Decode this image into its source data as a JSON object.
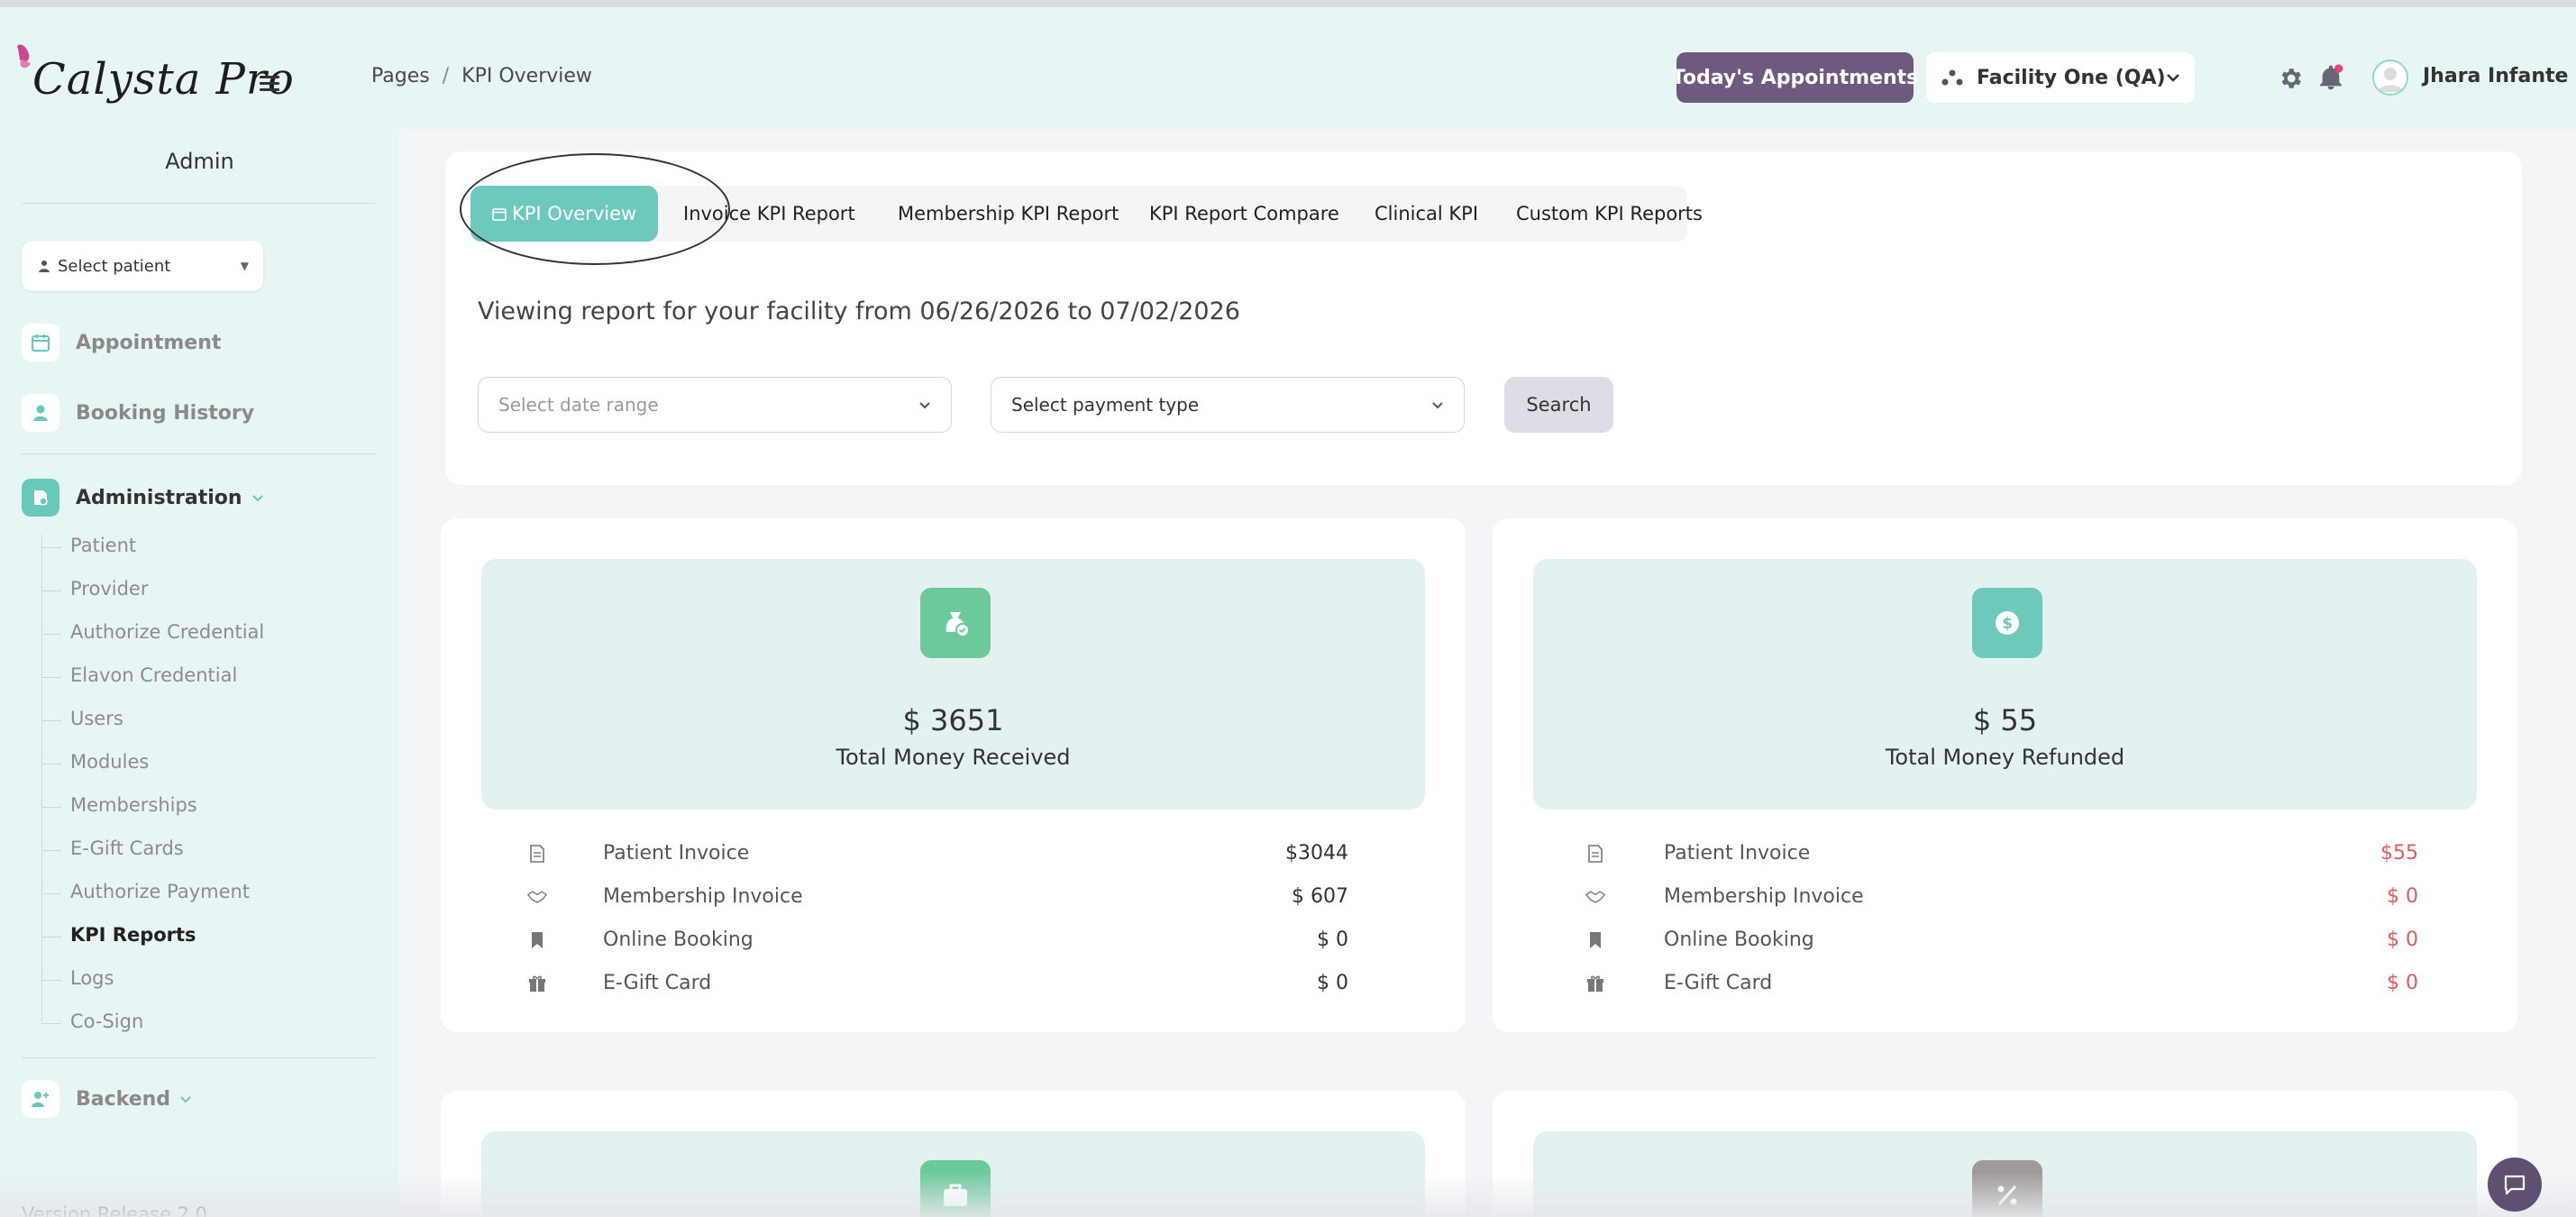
{
  "header": {
    "logo_text": "Calysta Pro",
    "breadcrumb": {
      "root": "Pages",
      "separator": "/",
      "current": "KPI Overview"
    },
    "today_button": "Today's Appointments",
    "facility": "Facility One (QA)",
    "user_name": "Jhara Infante"
  },
  "sidebar": {
    "section_title": "Admin",
    "select_patient": "Select patient",
    "items": [
      {
        "label": "Appointment",
        "icon": "calendar-icon"
      },
      {
        "label": "Booking History",
        "icon": "user-icon"
      },
      {
        "label": "Administration",
        "icon": "admin-icon"
      },
      {
        "label": "Backend",
        "icon": "backend-icon"
      }
    ],
    "admin_sub": [
      "Patient",
      "Provider",
      "Authorize Credential",
      "Elavon Credential",
      "Users",
      "Modules",
      "Memberships",
      "E-Gift Cards",
      "Authorize Payment",
      "KPI Reports",
      "Logs",
      "Co-Sign"
    ],
    "active_sub": "KPI Reports",
    "version": "Version Release 2.0"
  },
  "tabs": [
    "KPI Overview",
    "Invoice KPI Report",
    "Membership KPI Report",
    "KPI Report Compare",
    "Clinical KPI",
    "Custom KPI Reports"
  ],
  "report": {
    "viewing_text": "Viewing report for your facility from 06/26/2026 to 07/02/2026",
    "date_range_placeholder": "Select date range",
    "payment_type": "Select payment type",
    "search_label": "Search"
  },
  "cards": [
    {
      "amount": "$ 3651",
      "title": "Total Money Received",
      "rows": [
        {
          "label": "Patient Invoice",
          "value": "$3044"
        },
        {
          "label": "Membership Invoice",
          "value": "$ 607"
        },
        {
          "label": "Online Booking",
          "value": "$ 0"
        },
        {
          "label": "E-Gift Card",
          "value": "$ 0"
        }
      ]
    },
    {
      "amount": "$ 55",
      "title": "Total Money Refunded",
      "rows": [
        {
          "label": "Patient Invoice",
          "value": "$55"
        },
        {
          "label": "Membership Invoice",
          "value": "$ 0"
        },
        {
          "label": "Online Booking",
          "value": "$ 0"
        },
        {
          "label": "E-Gift Card",
          "value": "$ 0"
        }
      ]
    }
  ],
  "colors": {
    "teal": "#6cc9bc",
    "purple": "#6e5a7e",
    "refund_red": "#e25a5a",
    "card_bg": "#e3f2f1"
  }
}
